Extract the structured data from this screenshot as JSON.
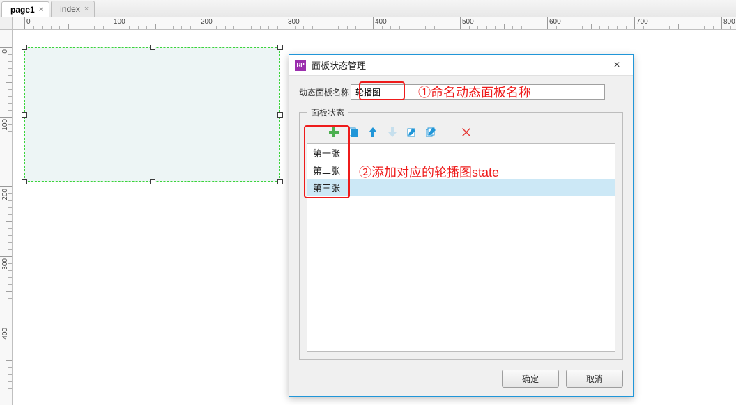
{
  "tabs": [
    {
      "label": "page1",
      "active": true
    },
    {
      "label": "index",
      "active": false
    }
  ],
  "h_ruler_labels": [
    "0",
    "100",
    "200",
    "300",
    "400",
    "500",
    "600",
    "700",
    "800"
  ],
  "v_ruler_labels": [
    "0",
    "100",
    "200",
    "300",
    "400"
  ],
  "dialog": {
    "title": "面板状态管理",
    "icon_text": "RP",
    "name_label": "动态面板名称",
    "name_value": "轮播图",
    "states_legend": "面板状态",
    "states": [
      "第一张",
      "第二张",
      "第三张"
    ],
    "selected_state_index": 2,
    "ok_label": "确定",
    "cancel_label": "取消"
  },
  "annotations": {
    "anno1_text": "①命名动态面板名称",
    "anno2_text": "②添加对应的轮播图state"
  }
}
